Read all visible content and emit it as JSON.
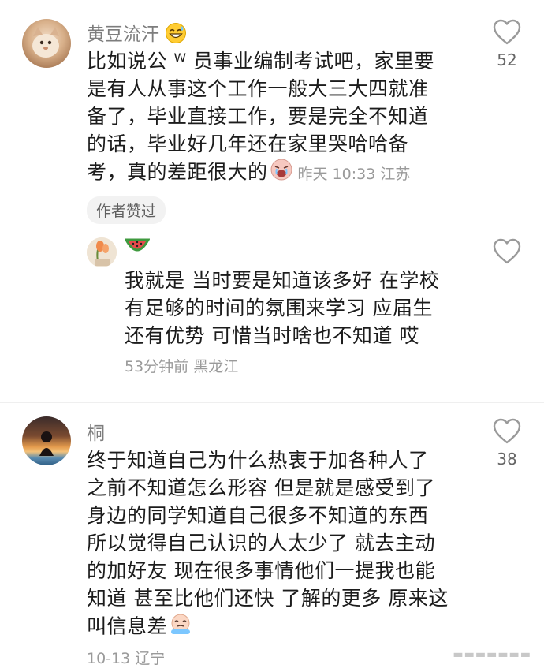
{
  "comments": [
    {
      "username": "黄豆流汗",
      "text_lines": [
        "比如说公 ᵂ 员事业编制考试吧，家里要",
        "是有人从事这个工作一般大三大四就准",
        "备了，毕业直接工作，要是完全不知道",
        "的话，毕业好几年还在家里哭哈哈备",
        "考，真的差距很大的"
      ],
      "meta": "昨天 10:33 江苏",
      "likes": "52",
      "badge": "作者赞过",
      "reply": {
        "text_lines": [
          "我就是 当时要是知道该多好 在学校",
          "有足够的时间的氛围来学习 应届生",
          "还有优势 可惜当时啥也不知道 哎"
        ],
        "meta": "53分钟前  黑龙江"
      }
    },
    {
      "username": "桐",
      "text_lines": [
        "终于知道自己为什么热衷于加各种人了",
        "之前不知道怎么形容 但是就是感受到了",
        "身边的同学知道自己很多不知道的东西",
        "所以觉得自己认识的人太少了 就去主动",
        "的加好友 现在很多事情他们一提我也能",
        "知道 甚至比他们还快 了解的更多 原来这",
        "叫信息差"
      ],
      "meta": "10-13 辽宁",
      "likes": "38"
    }
  ],
  "icons": {
    "like": "heart-outline-icon",
    "sweat_emoji": "grin-sweat-emoji",
    "cry_emoji": "crying-emoji",
    "watermelon": "watermelon-emoji",
    "tears_emoji": "tears-emoji"
  },
  "colors": {
    "text": "#1c1c1c",
    "meta": "#9a9a9a",
    "username": "#7d7d7d"
  }
}
